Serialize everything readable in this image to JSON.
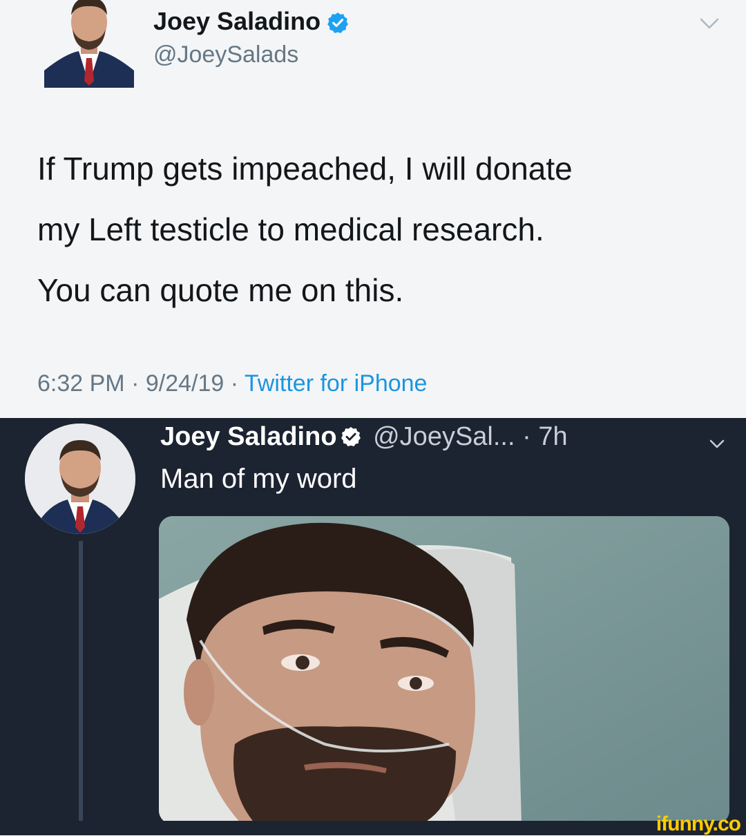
{
  "original_tweet": {
    "author_name": "Joey Saladino",
    "handle": "@JoeySalads",
    "text_lines": [
      "If Trump gets impeached, I will donate",
      "my Left testicle to medical research.",
      "You can quote me on this."
    ],
    "timestamp": "6:32 PM · 9/24/19 ·",
    "source": "Twitter for iPhone",
    "icons": [
      "verified-badge-icon",
      "chevron-down-icon"
    ],
    "colors": {
      "background": "#f4f5f6",
      "text": "#14171a",
      "muted": "#657786",
      "accent": "#1b95e0"
    }
  },
  "reply_tweet": {
    "author_name": "Joey Saladino",
    "handle": "@JoeySal...",
    "time": "· 7h",
    "text": "Man of my word",
    "icons": [
      "verified-badge-icon",
      "chevron-down-icon"
    ],
    "colors": {
      "background": "#1c2331",
      "text": "#ffffff",
      "muted": "#c9cfd8"
    }
  },
  "watermark": "ifunny.co"
}
